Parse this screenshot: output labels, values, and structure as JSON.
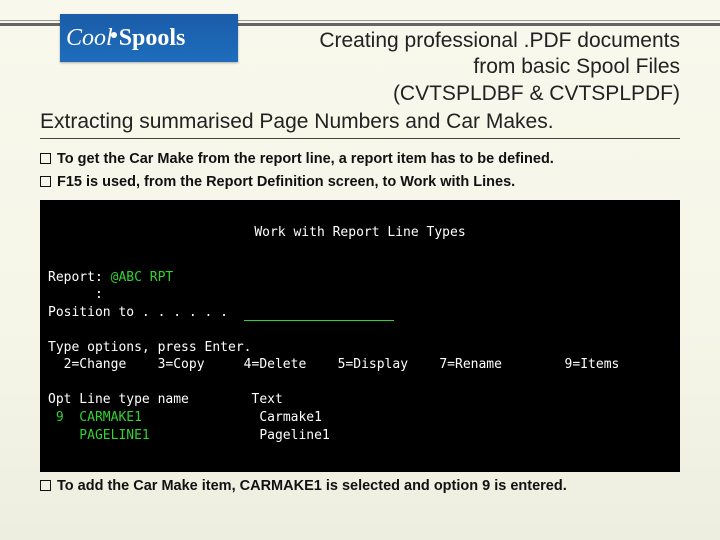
{
  "logo": {
    "part1": "Cool",
    "part2": "Spools"
  },
  "header": {
    "line1": "Creating professional .PDF documents",
    "line2": "from basic Spool Files",
    "line3": "(CVTSPLDBF & CVTSPLPDF)"
  },
  "subhead": "Extracting summarised Page Numbers and Car Makes.",
  "bullets": {
    "b1": "To get the Car Make from the report line, a report item has to be defined.",
    "b2": "F15 is used, from the Report Definition screen, to Work with Lines."
  },
  "terminal": {
    "title": "Work with Report Line Types",
    "report_label": "Report:",
    "report_value": "@ABC RPT",
    "colon_line": "      :",
    "position_label": "Position to . . . . . .",
    "instr1": "Type options, press Enter.",
    "opts": "  2=Change    3=Copy     4=Delete    5=Display    7=Rename        9=Items",
    "cols": "Opt Line type name        Text",
    "row1_opt": " 9",
    "row1_name": "  CARMAKE1",
    "row1_text": "Carmake1",
    "row2_opt": "  ",
    "row2_name": "  PAGELINE1",
    "row2_text": "Pageline1"
  },
  "footer": "To add the Car Make item, CARMAKE1 is selected and option 9 is entered."
}
